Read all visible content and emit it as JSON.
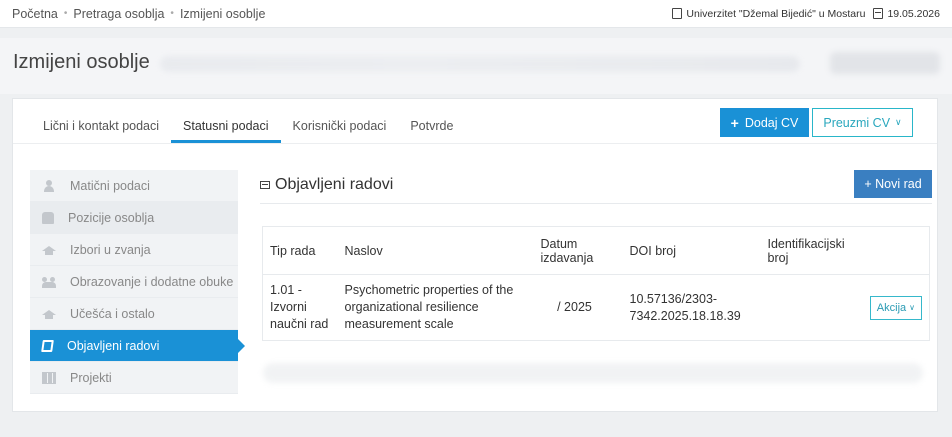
{
  "breadcrumbs": [
    "Početna",
    "Pretraga osoblja",
    "Izmijeni osoblje"
  ],
  "topbar": {
    "institution": "Univerzitet \"Džemal Bijedić\" u Mostaru",
    "date": "19.05.2026"
  },
  "page": {
    "title": "Izmijeni osoblje"
  },
  "tabs": [
    {
      "label": "Lični i kontakt podaci",
      "active": false
    },
    {
      "label": "Statusni podaci",
      "active": true
    },
    {
      "label": "Korisnički podaci",
      "active": false
    },
    {
      "label": "Potvrde",
      "active": false
    }
  ],
  "actions": {
    "add_cv": "Dodaj CV",
    "download_cv": "Preuzmi CV"
  },
  "sidebar": {
    "items": [
      {
        "label": "Matični podaci",
        "icon": "user-icon"
      },
      {
        "label": "Pozicije osoblja",
        "icon": "shirt-icon"
      },
      {
        "label": "Izbori u zvanja",
        "icon": "graduation-cap-icon"
      },
      {
        "label": "Obrazovanje i dodatne obuke",
        "icon": "group-icon"
      },
      {
        "label": "Učešća i ostalo",
        "icon": "graduation-cap-icon"
      },
      {
        "label": "Objavljeni radovi",
        "icon": "book-icon",
        "active": true
      },
      {
        "label": "Projekti",
        "icon": "grid-icon"
      }
    ]
  },
  "section": {
    "title": "Objavljeni radovi",
    "new_button": "+ Novi rad"
  },
  "table": {
    "headers": {
      "type": "Tip rada",
      "title": "Naslov",
      "date": "Datum izdavanja",
      "doi": "DOI broj",
      "id": "Identifikacijski broj"
    },
    "rows": [
      {
        "type": "1.01 - Izvorni naučni rad",
        "title": "Psychometric properties of the organizational resilience measurement scale",
        "date": "/ 2025",
        "doi": "10.57136/2303-7342.2025.18.18.39",
        "id": "",
        "action": "Akcija"
      }
    ]
  },
  "colors": {
    "primary": "#1a91d6",
    "accent": "#29b6c9",
    "button_dark": "#3a7fc1"
  }
}
